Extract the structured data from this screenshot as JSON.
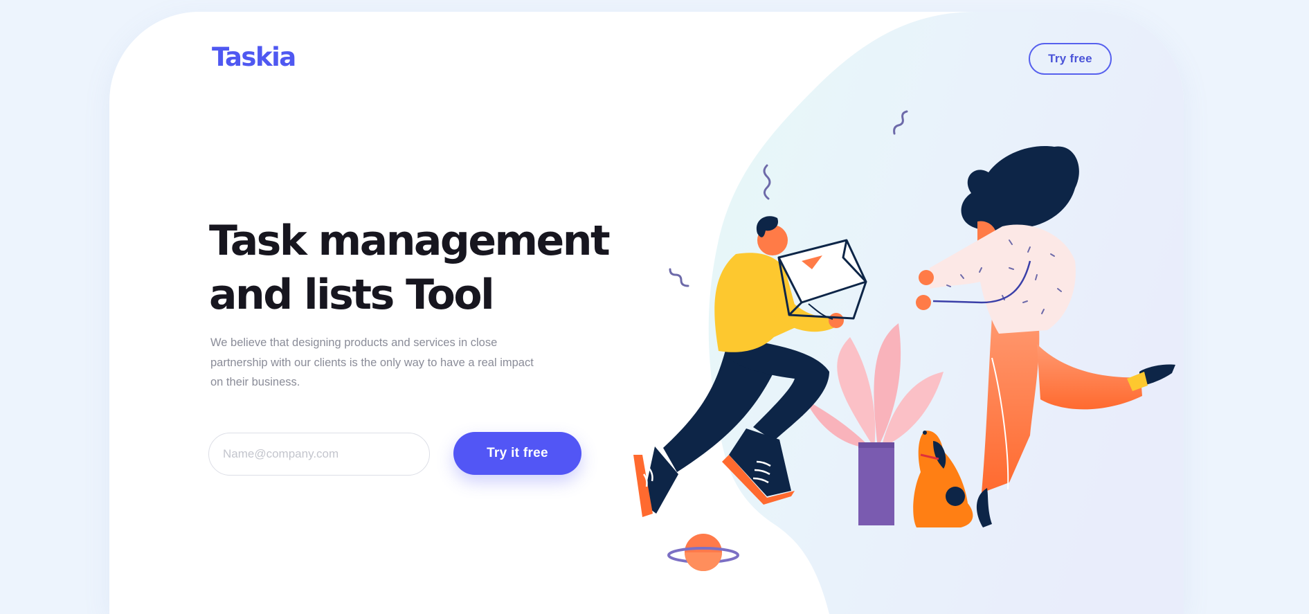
{
  "header": {
    "logo": "Taskia",
    "cta_label": "Try free"
  },
  "hero": {
    "title_line1": "Task management",
    "title_line2": "and lists Tool",
    "description": "We believe that designing products and services in close partnership with our clients is the only way to have a real impact on their business.",
    "email_placeholder": "Name@company.com",
    "email_value": "",
    "cta_label": "Try it free"
  },
  "colors": {
    "brand": "#4f58f1",
    "cta": "#5256f5",
    "heading": "#17161f",
    "body_text": "#8a8c98",
    "page_background": "#edf4fd",
    "accent_yellow": "#fdc82f",
    "accent_orange": "#ff7b47",
    "navy": "#0d2547",
    "purple": "#7a5bb0"
  },
  "illustration": {
    "name": "two-people-handing-box-illustration"
  }
}
